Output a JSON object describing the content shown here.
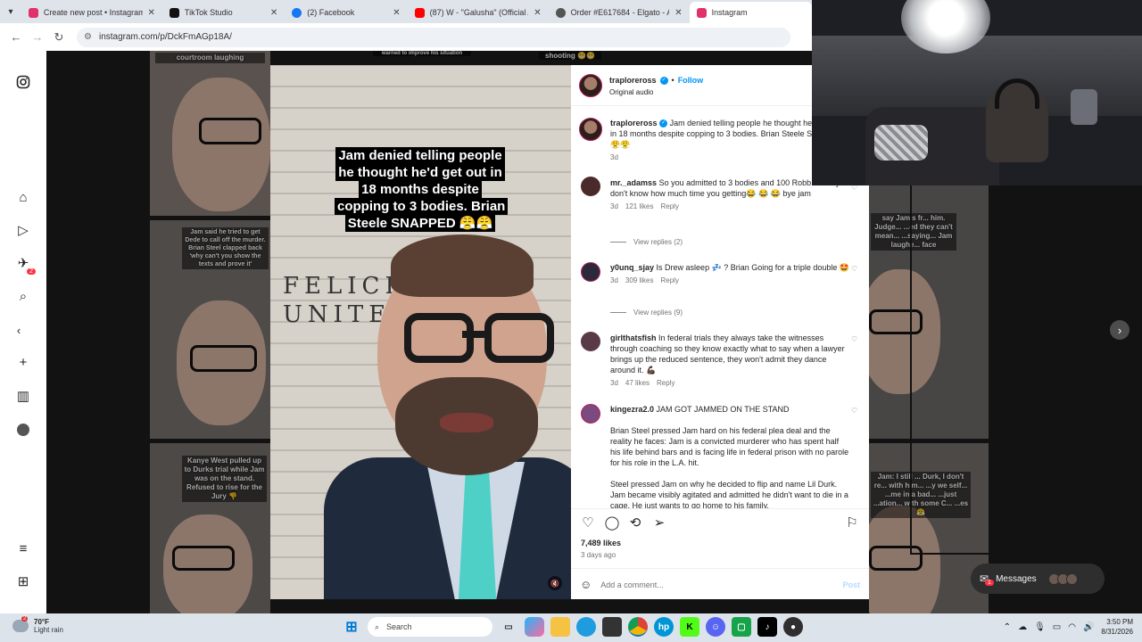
{
  "browser": {
    "tabs": [
      {
        "title": "Create new post • Instagram",
        "color": "#e1306c"
      },
      {
        "title": "TikTok Studio",
        "color": "#111111"
      },
      {
        "title": "(2) Facebook",
        "color": "#1877f2"
      },
      {
        "title": "(87) W - \"Galusha\" (Official Aud",
        "color": "#ff0000"
      },
      {
        "title": "Order #E617684 - Elgato - Acco",
        "color": "#555555"
      },
      {
        "title": "Instagram",
        "color": "#e1306c"
      }
    ],
    "url": "instagram.com/p/DckFmAGp18A/"
  },
  "background_captions": {
    "c1": "courtroom laughing",
    "c2": "warned to improve his situation",
    "c3": "shooting 😬😬",
    "c4": "Jam said he tried to get Dede to call off the murder. Brian Steel clapped back 'why can't you show the texts and prove it'",
    "c5": "Kanye West pulled up to Durks trial while Jam was on the stand. Refused to rise for the Jury 👎",
    "c6": "say Jam's fr... him. Judge... ...ed they can't mean... ...saying... Jam laughe... face",
    "c7": "Jam: I still ... Durk, I don't re... with him... ...y we self... ...me in a bad... ...just ...ation... with some C... ...es 😤"
  },
  "video": {
    "overlay_text": "Jam denied telling people he thought he'd get out in 18 months despite copping to 3 bodies. Brian Steele SNAPPED 😤😤",
    "sign_text": "FELICIT   N\nUNITE"
  },
  "post": {
    "username": "traploreross",
    "follow_label": "Follow",
    "audio": "Original audio",
    "caption": "Jam denied telling people he thought he'd get out in 18 months despite copping to 3 bodies. Brian Steele SNAPPED 😤😤",
    "caption_age": "3d",
    "likes": "7,489 likes",
    "posted": "3 days ago",
    "add_comment_placeholder": "Add a comment...",
    "post_label": "Post"
  },
  "comments": [
    {
      "user": "mr._adamss",
      "text": "So you admitted to 3 bodies and 100 Robb... and you don't know how much time you getting😂 😂 😂 bye jam",
      "age": "3d",
      "likes": "121 likes",
      "reply": "Reply",
      "view_replies": "View replies (2)"
    },
    {
      "user": "y0unq_sjay",
      "text": "Is Drew asleep 💤 ? Brian Going for a triple double 🤩",
      "age": "3d",
      "likes": "309 likes",
      "reply": "Reply",
      "view_replies": "View replies (9)"
    },
    {
      "user": "girlthatsfish",
      "text": "In federal trials they always take the witnesses through coaching so they know exactly what to say when a lawyer brings up the reduced sentence, they won't admit they dance around it. 💪🏿",
      "age": "3d",
      "likes": "47 likes",
      "reply": "Reply"
    },
    {
      "user": "kingezra2.0",
      "text": "JAM GOT JAMMED ON THE STAND",
      "para1": "Brian Steel pressed Jam hard on his federal plea deal and the reality he faces: Jam is a convicted murderer who has spent half his life behind bars and is facing life in federal prison with no parole for his role in the L.A. hit.",
      "para2": "Steel pressed Jam on why he decided to flip and name Lil Durk. Jam became visibly agitated and admitted he didn't want to die in a cage. He just wants to go home to his family."
    }
  ],
  "messages": {
    "label": "Messages",
    "badge": "1"
  },
  "sidenav_badge": "2",
  "taskbar": {
    "weather_temp": "70°F",
    "weather_desc": "Light rain",
    "weather_badge": "2",
    "search_placeholder": "Search",
    "time": "3:50 PM",
    "date": "8/31/2026"
  },
  "colors": {
    "accent": "#0095f6",
    "like_red": "#ff3040"
  }
}
